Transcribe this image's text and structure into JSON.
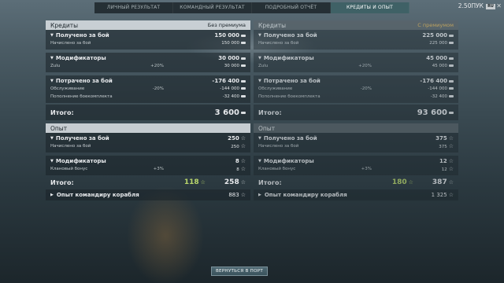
{
  "tabs": [
    {
      "label": "ЛИЧНЫЙ РЕЗУЛЬТАТ"
    },
    {
      "label": "КОМАНДНЫЙ РЕЗУЛЬТАТ"
    },
    {
      "label": "ПОДРОБНЫЙ ОТЧЁТ"
    },
    {
      "label": "КРЕДИТЫ И ОПЫТ"
    }
  ],
  "account": {
    "name": "2.50ПУК",
    "lang": "RU"
  },
  "credits_left": {
    "title": "Кредиты",
    "mode": "Без премиума",
    "earned": {
      "label": "Получено за бой",
      "value": "150 000",
      "sub_label": "Начислено за бой",
      "sub_value": "150 000"
    },
    "modifiers": {
      "label": "Модификаторы",
      "value": "30 000",
      "sub_label": "Zulu",
      "sub_pct": "+20%",
      "sub_value": "30 000"
    },
    "spent": {
      "label": "Потрачено за бой",
      "value": "-176 400",
      "rows": [
        {
          "label": "Обслуживание",
          "pct": "-20%",
          "value": "-144 000"
        },
        {
          "label": "Пополнение боекомплекта",
          "pct": "",
          "value": "-32 400"
        }
      ]
    },
    "total_label": "Итого:",
    "total": "3 600"
  },
  "credits_right": {
    "title": "Кредиты",
    "mode": "С премиумом",
    "earned": {
      "label": "Получено за бой",
      "value": "225 000",
      "sub_label": "Начислено за бой",
      "sub_value": "225 000"
    },
    "modifiers": {
      "label": "Модификаторы",
      "value": "45 000",
      "sub_label": "Zulu",
      "sub_pct": "+20%",
      "sub_value": "45 000"
    },
    "spent": {
      "label": "Потрачено за бой",
      "value": "-176 400",
      "rows": [
        {
          "label": "Обслуживание",
          "pct": "-20%",
          "value": "-144 000"
        },
        {
          "label": "Пополнение боекомплекта",
          "pct": "",
          "value": "-32 400"
        }
      ]
    },
    "total_label": "Итого:",
    "total": "93 600"
  },
  "xp_left": {
    "title": "Опыт",
    "earned": {
      "label": "Получено за бой",
      "value": "250",
      "sub_label": "Начислено за бой",
      "sub_value": "250"
    },
    "modifiers": {
      "label": "Модификаторы",
      "value": "8",
      "sub_label": "Клановый бонус",
      "sub_pct": "+3%",
      "sub_value": "8"
    },
    "total_label": "Итого:",
    "base": "118",
    "total": "258",
    "captain_label": "Опыт командиру корабля",
    "captain_value": "883"
  },
  "xp_right": {
    "title": "Опыт",
    "earned": {
      "label": "Получено за бой",
      "value": "375",
      "sub_label": "Начислено за бой",
      "sub_value": "375"
    },
    "modifiers": {
      "label": "Модификаторы",
      "value": "12",
      "sub_label": "Клановый бонус",
      "sub_pct": "+3%",
      "sub_value": "12"
    },
    "total_label": "Итого:",
    "base": "180",
    "total": "387",
    "captain_label": "Опыт командиру корабля",
    "captain_value": "1 325"
  },
  "return_button": "ВЕРНУТЬСЯ В ПОРТ",
  "colors": {
    "active_tab": "#466e73",
    "premium_accent": "#e3b85a",
    "base_xp": "#b9d66b"
  }
}
